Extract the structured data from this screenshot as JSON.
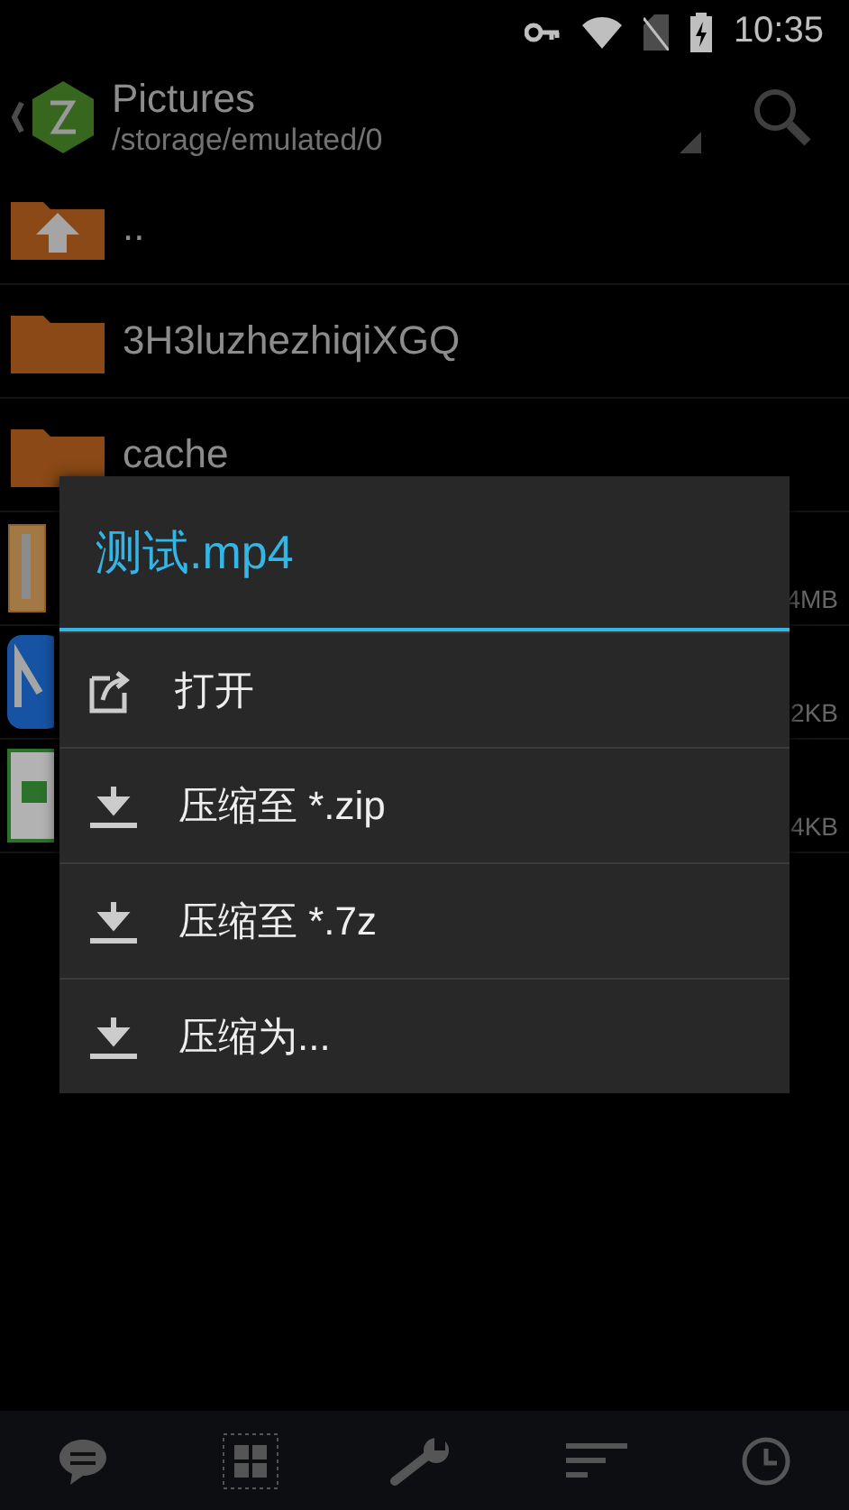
{
  "status_bar": {
    "time": "10:35"
  },
  "header": {
    "title": "Pictures",
    "path": "/storage/emulated/0"
  },
  "files": [
    {
      "kind": "up",
      "name": ".."
    },
    {
      "kind": "folder",
      "name": "3H3luzhezhiqiXGQ"
    },
    {
      "kind": "folder",
      "name": "cache"
    },
    {
      "kind": "archive",
      "size": "4MB"
    },
    {
      "kind": "app",
      "size": "2KB"
    },
    {
      "kind": "image",
      "size": "4KB"
    }
  ],
  "dialog": {
    "title": "测试.mp4",
    "items": [
      {
        "kind": "open",
        "label": "打开"
      },
      {
        "kind": "compress",
        "label": "压缩至 *.zip"
      },
      {
        "kind": "compress",
        "label": "压缩至 *.7z"
      },
      {
        "kind": "compress",
        "label": "压缩为..."
      }
    ]
  },
  "bottom_bar": [
    {
      "kind": "chat"
    },
    {
      "kind": "grid"
    },
    {
      "kind": "wrench"
    },
    {
      "kind": "sort"
    },
    {
      "kind": "clock"
    }
  ]
}
